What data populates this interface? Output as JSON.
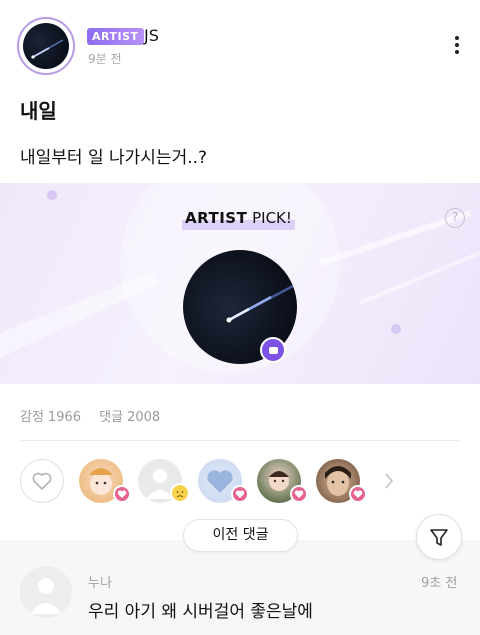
{
  "post": {
    "artist_badge": "ARTIST",
    "author": "JS",
    "time": "9분 전",
    "title": "내일",
    "body": "내일부터 일 나가시는거..?"
  },
  "artist_pick": {
    "title_bold": "ARTIST",
    "title_rest": " PICK!",
    "help_symbol": "?",
    "accent_color": "#7b51e6"
  },
  "stats": {
    "reactions_label": "감정",
    "reactions_count": "1966",
    "comments_label": "댓글",
    "comments_count": "2008"
  },
  "reactions": {
    "like_icon": "heart-outline-icon",
    "users": [
      {
        "emotion": "heart",
        "color": "#e7628c"
      },
      {
        "emotion": "sad",
        "color": "#f7d34a"
      },
      {
        "emotion": "heart",
        "color": "#e7628c"
      },
      {
        "emotion": "heart",
        "color": "#e7628c"
      },
      {
        "emotion": "heart",
        "color": "#e7628c"
      }
    ]
  },
  "comments": {
    "prev_button": "이전 댓글",
    "filter_icon": "filter-funnel-icon",
    "items": [
      {
        "author": "누나",
        "time": "9초 전",
        "text": "우리 아기 왜 시버걸어 좋은날에"
      }
    ]
  }
}
